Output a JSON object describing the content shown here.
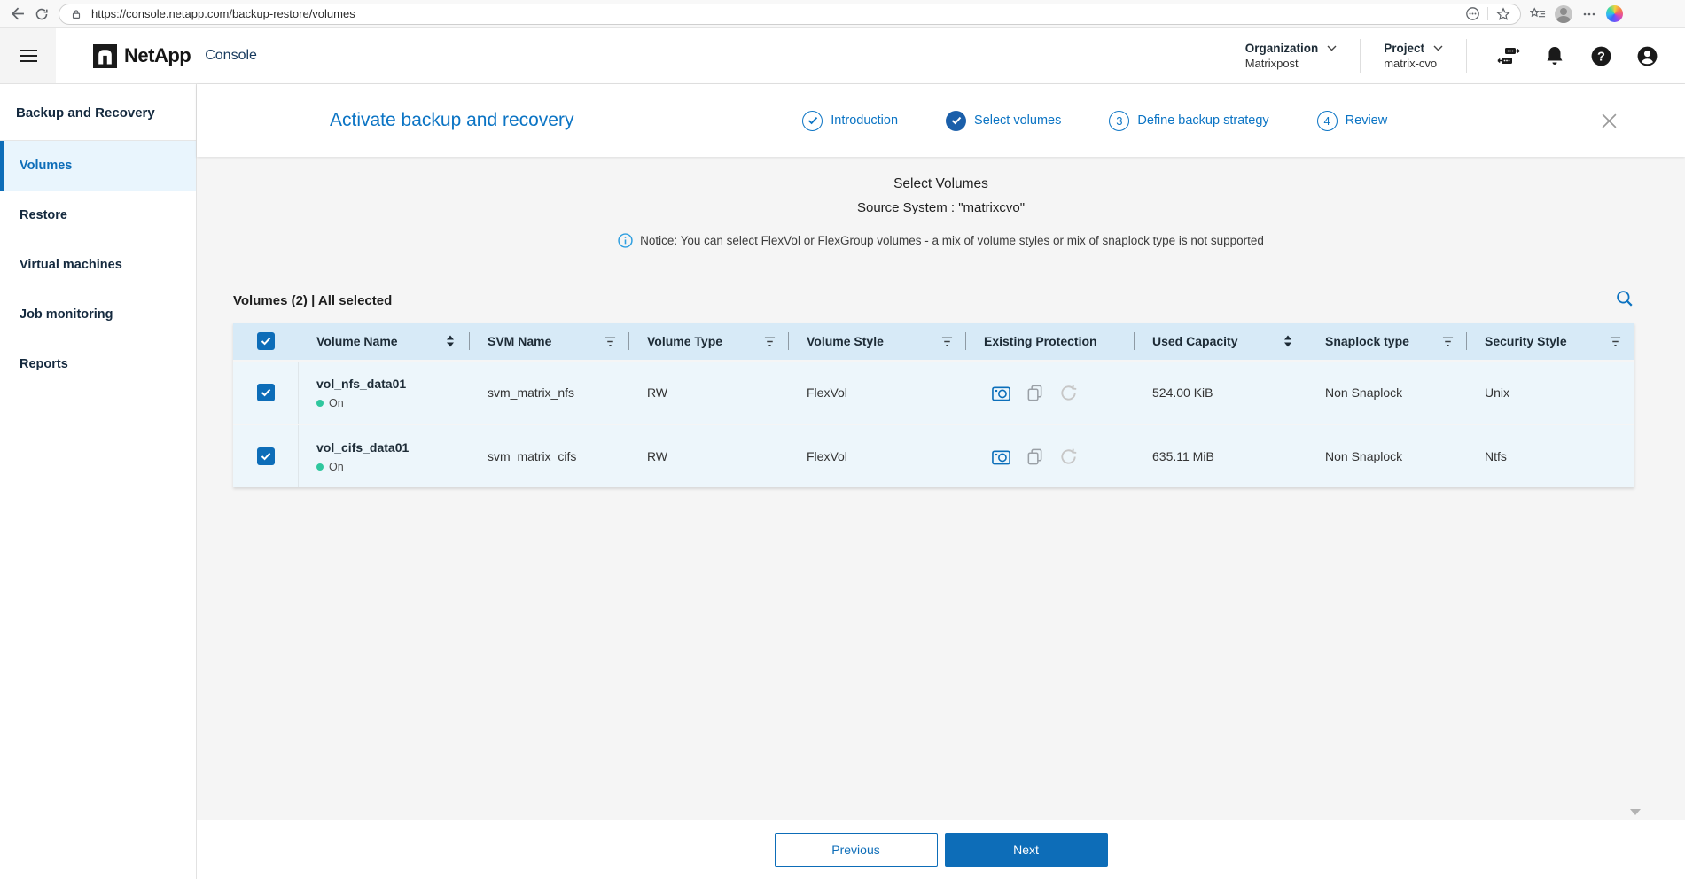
{
  "browser": {
    "url": "https://console.netapp.com/backup-restore/volumes"
  },
  "header": {
    "logo_text": "NetApp",
    "product": "Console",
    "organization_label": "Organization",
    "organization_value": "Matrixpost",
    "project_label": "Project",
    "project_value": "matrix-cvo"
  },
  "sidebar": {
    "heading": "Backup and Recovery",
    "items": [
      {
        "label": "Volumes"
      },
      {
        "label": "Restore"
      },
      {
        "label": "Virtual machines"
      },
      {
        "label": "Job monitoring"
      },
      {
        "label": "Reports"
      }
    ]
  },
  "wizard": {
    "title": "Activate backup and recovery",
    "steps": [
      {
        "label": "Introduction"
      },
      {
        "label": "Select volumes"
      },
      {
        "label": "Define backup strategy",
        "number": "3"
      },
      {
        "label": "Review",
        "number": "4"
      }
    ]
  },
  "content": {
    "title": "Select Volumes",
    "subtitle": "Source System : \"matrixcvo\"",
    "notice": "Notice: You can select FlexVol or FlexGroup volumes - a mix of volume styles or mix of snaplock type is not supported",
    "caption": "Volumes (2) | All selected",
    "columns": [
      "Volume Name",
      "SVM Name",
      "Volume Type",
      "Volume Style",
      "Existing Protection",
      "Used Capacity",
      "Snaplock type",
      "Security Style"
    ],
    "rows": [
      {
        "name": "vol_nfs_data01",
        "status": "On",
        "svm": "svm_matrix_nfs",
        "type": "RW",
        "style": "FlexVol",
        "capacity": "524.00 KiB",
        "snaplock": "Non Snaplock",
        "security": "Unix"
      },
      {
        "name": "vol_cifs_data01",
        "status": "On",
        "svm": "svm_matrix_cifs",
        "type": "RW",
        "style": "FlexVol",
        "capacity": "635.11 MiB",
        "snaplock": "Non Snaplock",
        "security": "Ntfs"
      }
    ]
  },
  "footer": {
    "previous": "Previous",
    "next": "Next"
  },
  "colors": {
    "accent": "#0d6db8",
    "step_text": "#0b74c4",
    "step_current_bg": "#1b5faa",
    "table_header_bg": "#d7eaf7",
    "selected_row_bg": "#edf6fb",
    "status_on": "#2fc79e",
    "content_bg": "#f5f5f5"
  }
}
